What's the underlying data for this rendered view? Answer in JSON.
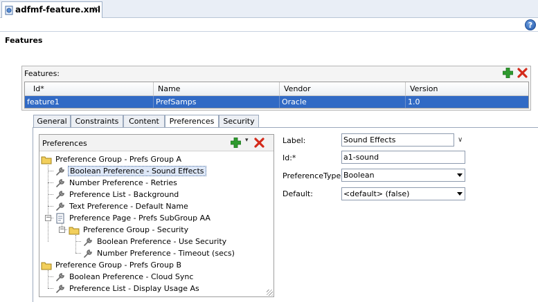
{
  "editor": {
    "tab_title": "adfmf-feature.xml",
    "close_glyph": "×",
    "help_glyph": "?"
  },
  "section": {
    "title": "Features"
  },
  "features_table": {
    "label": "Features:",
    "columns": [
      "Id*",
      "Name",
      "Vendor",
      "Version"
    ],
    "rows": [
      {
        "id": "feature1",
        "name": "PrefSamps",
        "vendor": "Oracle",
        "version": "1.0"
      }
    ]
  },
  "tabs": [
    "General",
    "Constraints",
    "Content",
    "Preferences",
    "Security"
  ],
  "active_tab": "Preferences",
  "preferences_tree": {
    "label": "Preferences",
    "nodes": [
      {
        "text": "Preference Group - Prefs Group A",
        "icon": "folder-icon"
      },
      {
        "text": "Boolean Preference - Sound Effects",
        "icon": "wrench-icon",
        "selected": true
      },
      {
        "text": "Number Preference - Retries",
        "icon": "wrench-icon"
      },
      {
        "text": "Preference List - Background",
        "icon": "wrench-icon"
      },
      {
        "text": "Text Preference - Default Name",
        "icon": "wrench-icon"
      },
      {
        "text": "Preference Page - Prefs SubGroup AA",
        "icon": "page-icon"
      },
      {
        "text": "Preference Group - Security",
        "icon": "folder-icon"
      },
      {
        "text": "Boolean Preference - Use Security",
        "icon": "wrench-icon"
      },
      {
        "text": "Number Preference - Timeout (secs)",
        "icon": "wrench-icon"
      },
      {
        "text": "Preference Group - Prefs Group B",
        "icon": "folder-icon"
      },
      {
        "text": "Boolean Preference - Cloud Sync",
        "icon": "wrench-icon"
      },
      {
        "text": "Preference List - Display Usage As",
        "icon": "wrench-icon"
      }
    ]
  },
  "properties": {
    "label_label": "Label:",
    "label_value": "Sound Effects",
    "id_label": "Id:*",
    "id_value": "a1-sound",
    "type_label": "PreferenceType:",
    "type_value": "Boolean",
    "default_label": "Default:",
    "default_value": "<default> (false)"
  },
  "colors": {
    "selection": "#316ac5",
    "add": "#2e9a2e",
    "delete": "#d42a1a"
  }
}
